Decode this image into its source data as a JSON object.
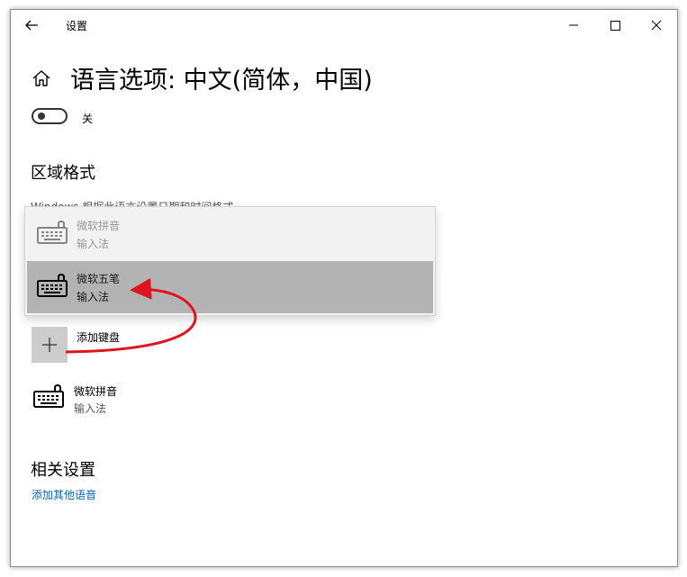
{
  "window": {
    "title": "设置"
  },
  "header": {
    "title": "语言选项: 中文(简体，中国)"
  },
  "toggle": {
    "label": "关",
    "state": "off"
  },
  "region": {
    "heading": "区域格式",
    "description": "Windows 根据此语言设置日期和时间格式"
  },
  "dropdown": {
    "items": [
      {
        "name": "微软拼音",
        "sub": "输入法",
        "icon": "keyboard-icon",
        "state": "disabled"
      },
      {
        "name": "微软五笔",
        "sub": "输入法",
        "icon": "keyboard-icon",
        "state": "highlighted"
      }
    ]
  },
  "keyboard": {
    "add_label": "添加键盘",
    "installed": [
      {
        "name": "微软拼音",
        "sub": "输入法",
        "icon": "keyboard-icon"
      }
    ]
  },
  "related": {
    "heading": "相关设置",
    "link": "添加其他语音"
  },
  "colors": {
    "accent": "#0067b8",
    "highlight": "#b3b3b3",
    "annotation_arrow": "#e0141e"
  }
}
